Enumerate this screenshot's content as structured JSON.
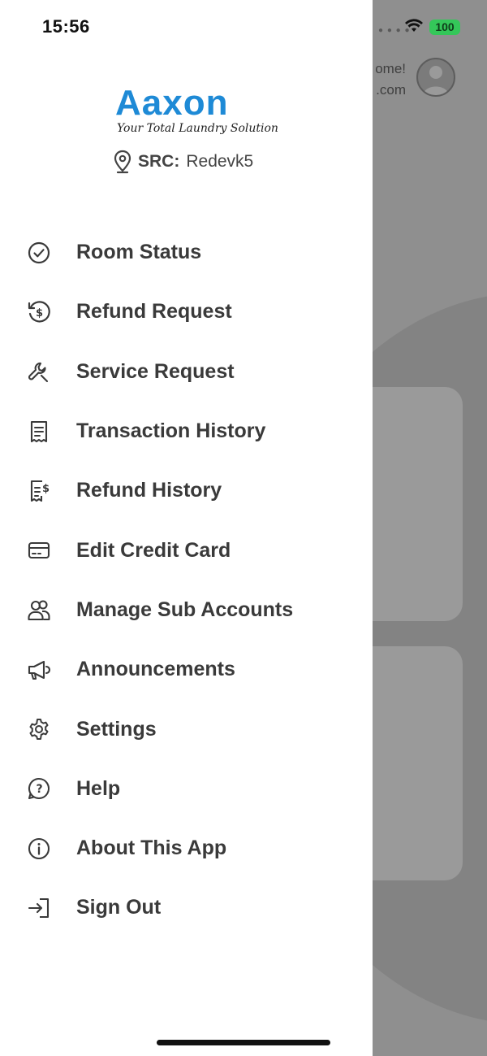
{
  "status_bar": {
    "time": "15:56",
    "battery": "100"
  },
  "background": {
    "welcome_line1": "ome!",
    "welcome_line2": ".com"
  },
  "drawer": {
    "logo_text": "Aaxon",
    "logo_tagline": "Your Total Laundry Solution",
    "src_label": "SRC:",
    "src_value": "Redevk5",
    "menu": [
      {
        "label": "Room Status",
        "icon": "check-circle-icon"
      },
      {
        "label": "Refund Request",
        "icon": "refund-icon"
      },
      {
        "label": "Service Request",
        "icon": "wrench-icon"
      },
      {
        "label": "Transaction History",
        "icon": "receipt-icon"
      },
      {
        "label": "Refund History",
        "icon": "receipt-dollar-icon"
      },
      {
        "label": "Edit Credit Card",
        "icon": "credit-card-icon"
      },
      {
        "label": "Manage Sub Accounts",
        "icon": "users-icon"
      },
      {
        "label": "Announcements",
        "icon": "megaphone-icon"
      },
      {
        "label": "Settings",
        "icon": "gear-icon"
      },
      {
        "label": "Help",
        "icon": "help-icon"
      },
      {
        "label": "About This App",
        "icon": "info-icon"
      },
      {
        "label": "Sign Out",
        "icon": "sign-out-icon"
      }
    ]
  },
  "colors": {
    "brand": "#1e8ad6",
    "battery": "#34c759",
    "menu_text": "#3a3a3a"
  }
}
